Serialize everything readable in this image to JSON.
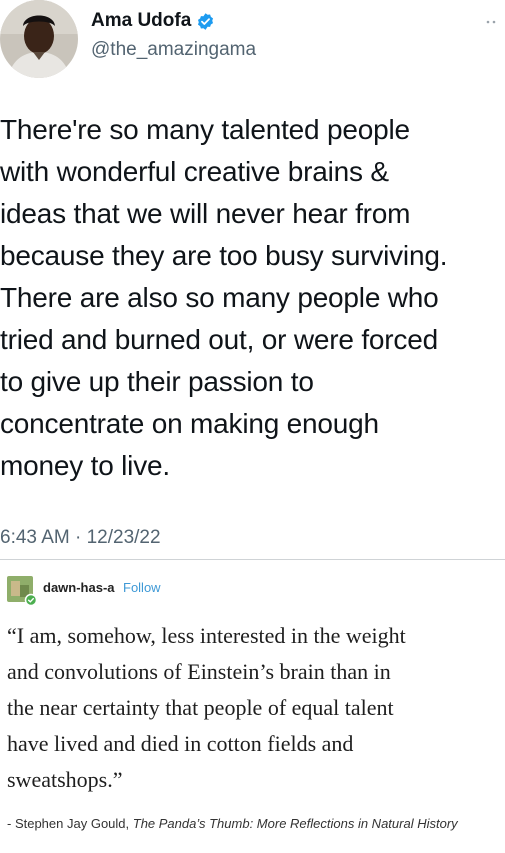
{
  "tweet": {
    "display_name": "Ama Udofa",
    "handle": "@the_amazingama",
    "verified": true,
    "lines": [
      "There're so many talented people",
      "with wonderful creative brains &",
      "ideas that we will never hear from",
      "because they are too busy surviving.",
      "There are also so many people who",
      "tried and burned out, or were forced",
      "to give up their passion to",
      "concentrate on making enough",
      "money to live."
    ],
    "timestamp": "6:43 AM · 12/23/22"
  },
  "tumblr": {
    "username": "dawn-has-a",
    "follow_label": "Follow",
    "quote_lines": [
      "“I am, somehow, less interested in the weight",
      "and convolutions of Einstein’s brain than in",
      "the near certainty that people of equal talent",
      "have lived and died in cotton fields and",
      "sweatshops.”"
    ],
    "attribution_prefix": "- Stephen Jay Gould, ",
    "attribution_book": "The Panda’s Thumb: More Reflections in Natural History"
  },
  "colors": {
    "verified": "#1d9bf0",
    "follow": "#3e99d6",
    "secondary_text": "#536471"
  },
  "icons": {
    "verified": "verified-badge-icon",
    "more": "more-options-icon",
    "tumblr_avatar": "tumblr-avatar"
  }
}
